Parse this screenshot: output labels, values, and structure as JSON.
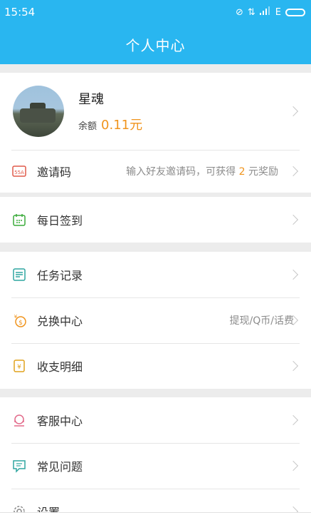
{
  "status": {
    "time": "15:54",
    "network": "E"
  },
  "header": {
    "title": "个人中心"
  },
  "profile": {
    "name": "星魂",
    "balance_label": "余额",
    "balance_value": "0.11元"
  },
  "invite": {
    "label": "邀请码",
    "hint_prefix": "输入好友邀请码，可获得",
    "hint_number": "2",
    "hint_suffix": "元奖励"
  },
  "menu": {
    "checkin": "每日签到",
    "tasks": "任务记录",
    "exchange": "兑换中心",
    "exchange_hint": "提现/Q币/话费",
    "ledger": "收支明细",
    "service": "客服中心",
    "faq": "常见问题",
    "settings": "设置"
  },
  "colors": {
    "header": "#29b6f0",
    "accent": "#f0941d"
  }
}
